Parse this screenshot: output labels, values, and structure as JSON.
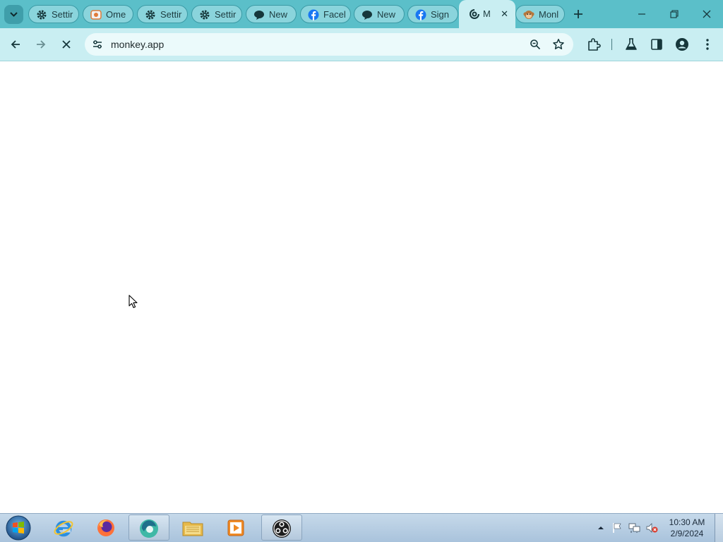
{
  "browser": {
    "tabs": [
      {
        "title": "Settir",
        "icon": "gear-icon"
      },
      {
        "title": "Ome",
        "icon": "omegle-icon"
      },
      {
        "title": "Settir",
        "icon": "gear-icon"
      },
      {
        "title": "Settir",
        "icon": "gear-icon"
      },
      {
        "title": "New",
        "icon": "chat-bubble-icon"
      },
      {
        "title": "Facel",
        "icon": "facebook-icon"
      },
      {
        "title": "New",
        "icon": "chat-bubble-icon"
      },
      {
        "title": "Sign",
        "icon": "facebook-icon"
      },
      {
        "title": "M",
        "icon": "loading-icon",
        "active": true
      },
      {
        "title": "Monl",
        "icon": "monkey-icon"
      }
    ],
    "active_tab_close": "✕",
    "address_bar": {
      "url": "monkey.app"
    },
    "theme": {
      "tabstrip": "#5bbfc9",
      "toolbar": "#c9eef2",
      "omnibox": "#ebfafb"
    }
  },
  "taskbar": {
    "apps": [
      "internet-explorer-icon",
      "firefox-icon",
      "browser-icon",
      "file-explorer-icon",
      "media-player-icon",
      "obs-icon"
    ],
    "clock": {
      "time": "10:30 AM",
      "date": "2/9/2024"
    }
  }
}
